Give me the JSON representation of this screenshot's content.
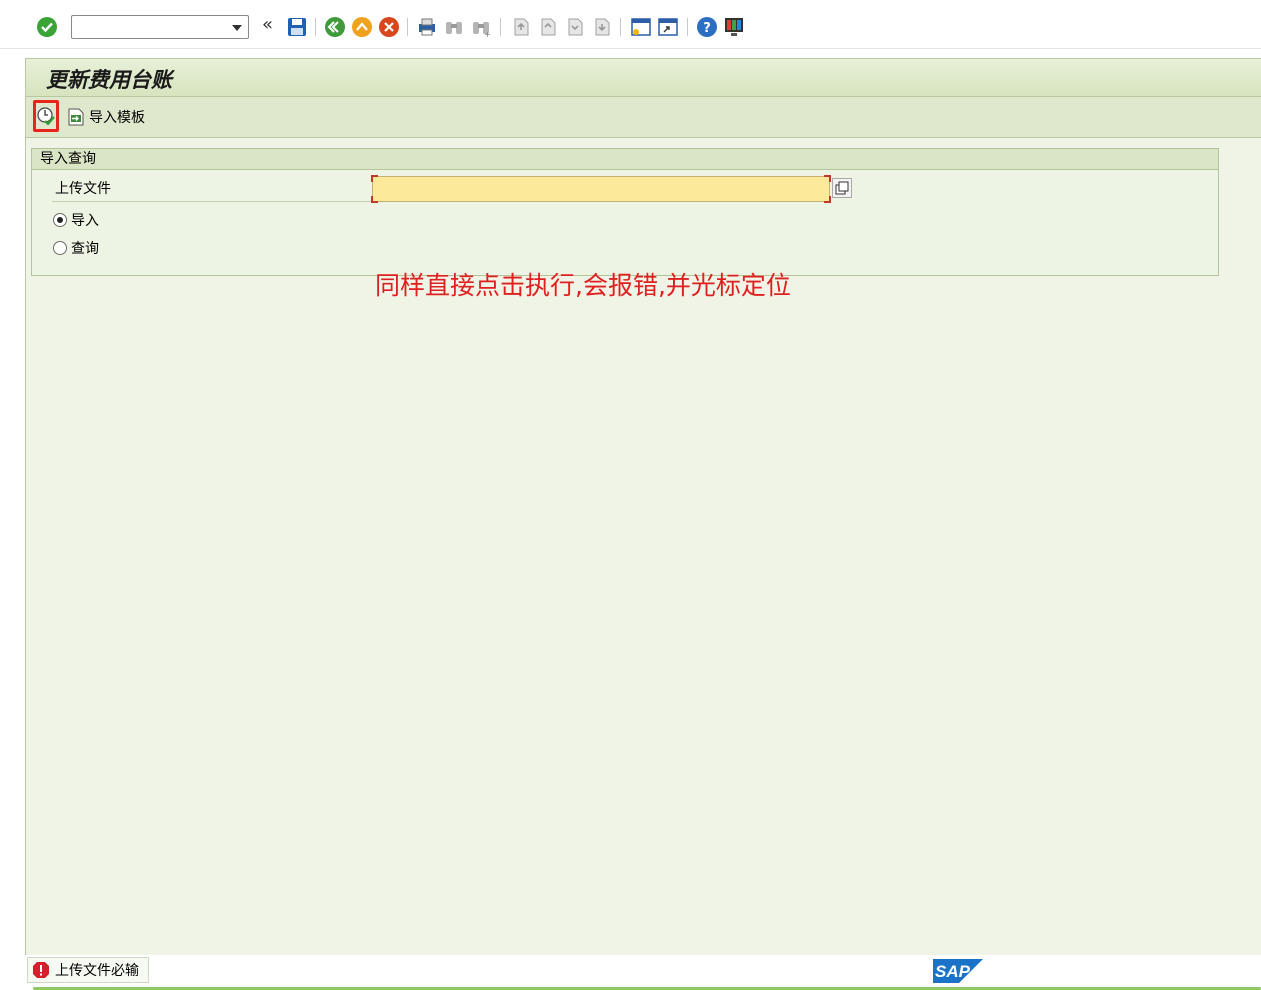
{
  "toolbar": {
    "command_field_value": "",
    "history_arrows": "«"
  },
  "screen": {
    "title": "更新费用台账"
  },
  "app_toolbar": {
    "import_template_label": "导入模板"
  },
  "group": {
    "title": "导入查询",
    "upload_label": "上传文件",
    "upload_value": "",
    "radio_import_label": "导入",
    "radio_query_label": "查询",
    "selected_radio": "导入"
  },
  "annotation": "同样直接点击执行,会报错,并光标定位",
  "status": {
    "message": "上传文件必输",
    "type": "error"
  },
  "brand": {
    "logo_text": "SAP"
  },
  "colors": {
    "annotation": "#e02020",
    "highlight_box": "#e8251a",
    "required_field": "#fce99a",
    "frame_bg": "#eff4e6",
    "sap_blue": "#1a73c9"
  }
}
